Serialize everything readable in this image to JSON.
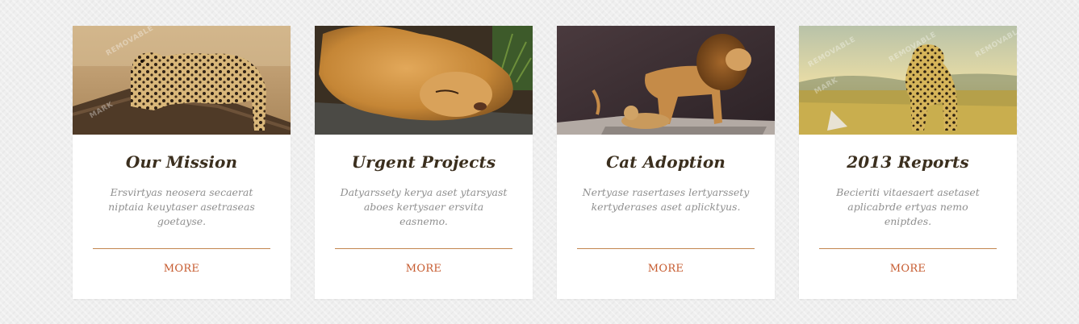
{
  "watermark": "REMOVABLE WATERMARK",
  "cards": [
    {
      "title": "Our Mission",
      "text": "Ersvirtyas neosera secaerat niptaia keuytaser asetraseas goetayse.",
      "more": "MORE",
      "image": "leopard-on-log",
      "watermark_words": [
        "REMOVABLE",
        "MARK"
      ]
    },
    {
      "title": "Urgent Projects",
      "text": "Datyarssety kerya aset ytarsyast aboes kertysaer ersvita easnemo.",
      "more": "MORE",
      "image": "sleeping-lioness",
      "watermark_words": []
    },
    {
      "title": "Cat Adoption",
      "text": "Nertyase rasertases lertyarssety kertyderases aset aplicktyus.",
      "more": "MORE",
      "image": "lion-and-cub",
      "watermark_words": []
    },
    {
      "title": "2013 Reports",
      "text": "Becieriti vitaesaert asetaset aplicabrde ertyas nemo eniptdes.",
      "more": "MORE",
      "image": "cheetah-in-grass",
      "watermark_words": [
        "REMOVABLE",
        "REMOVABLE",
        "REMOVABLE",
        "MARK"
      ]
    }
  ],
  "colors": {
    "background": "#efefef",
    "card": "#ffffff",
    "title": "#3b2f1e",
    "text": "#8f8f8f",
    "divider": "#c2864e",
    "link": "#c65a2e"
  }
}
